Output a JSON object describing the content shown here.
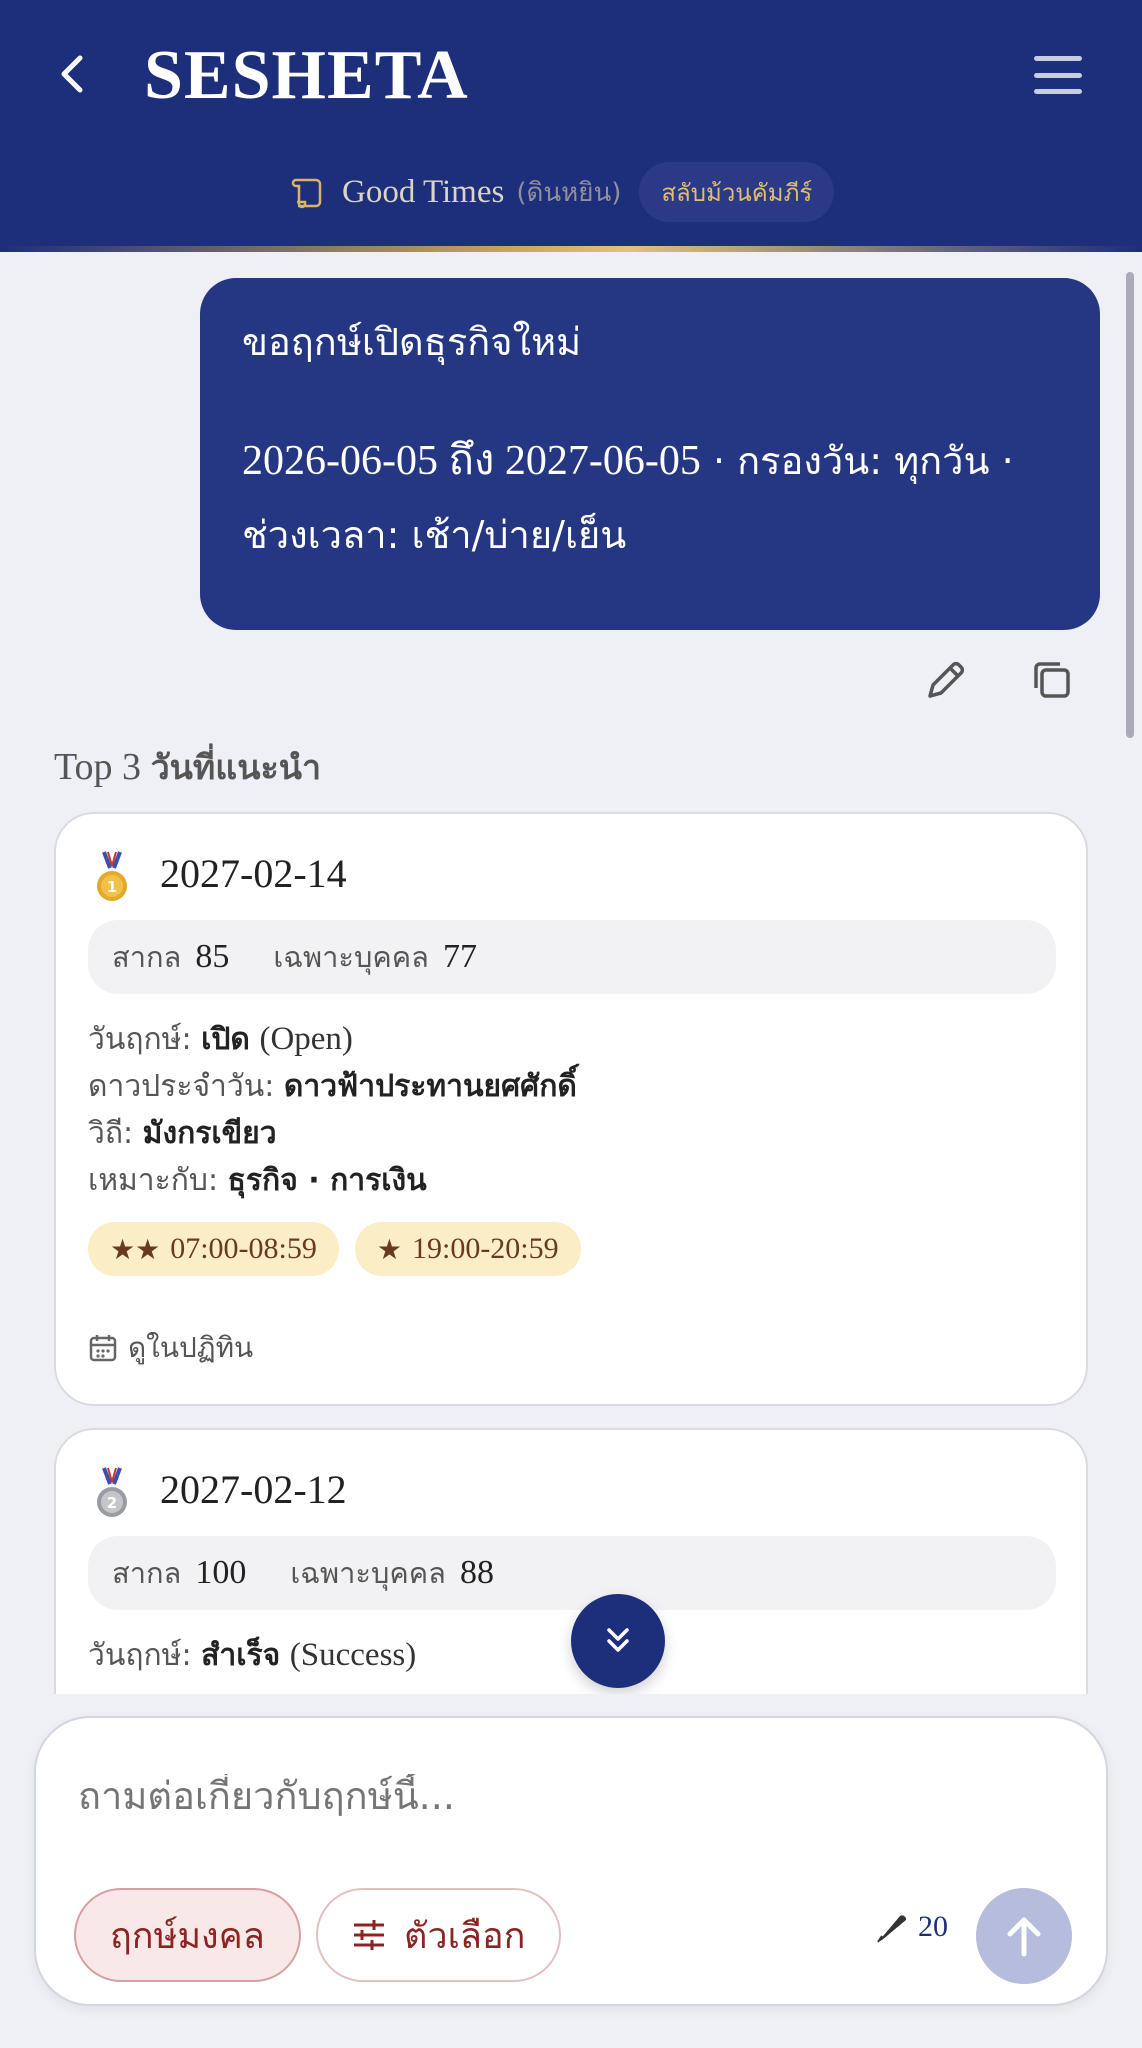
{
  "header": {
    "app_title": "SESHETA",
    "scroll_name": "Good Times",
    "scroll_sub": "(ดินหยิน)",
    "switch_label": "สลับม้วนคัมภีร์",
    "icons": [
      "back-chevron-icon",
      "hamburger-menu-icon",
      "scroll-icon"
    ],
    "accent_color": "#1d2e7a",
    "gold_color": "#e3bd6c"
  },
  "user_message": {
    "line1": "ขอฤกษ์เปิดธุรกิจใหม่",
    "date_range": "2026-06-05 ถึง 2027-06-05",
    "filter_text": " · กรองวัน: ทุกวัน · ช่วงเวลา: เช้า/บ่าย/เย็น",
    "actions": [
      "pencil-icon",
      "copy-icon"
    ]
  },
  "section": {
    "prefix": "Top 3",
    "title": "วันที่แนะนำ"
  },
  "results": [
    {
      "rank_icon": "gold-medal-icon",
      "date": "2027-02-14",
      "score_universal_label": "สากล",
      "score_universal": "85",
      "score_personal_label": "เฉพาะบุคคล",
      "score_personal": "77",
      "day_type_label": "วันฤกษ์:",
      "day_type": "เปิด",
      "day_type_en": "(Open)",
      "star_label": "ดาวประจำวัน:",
      "star": "ดาวฟ้าประทานยศศักดิ์",
      "path_label": "วิถี:",
      "path": "มังกรเขียว",
      "suited_label": "เหมาะกับ:",
      "suited": "ธุรกิจ · การเงิน",
      "slots": [
        {
          "stars": "★★",
          "time": "07:00-08:59"
        },
        {
          "stars": "★",
          "time": "19:00-20:59"
        }
      ],
      "calendar_link": "ดูในปฏิทิน"
    },
    {
      "rank_icon": "silver-medal-icon",
      "date": "2027-02-12",
      "score_universal_label": "สากล",
      "score_universal": "100",
      "score_personal_label": "เฉพาะบุคคล",
      "score_personal": "88",
      "day_type_label": "วันฤกษ์:",
      "day_type": "สำเร็จ",
      "day_type_en": "(Success)"
    }
  ],
  "composer": {
    "placeholder": "ถามต่อเกี่ยวกับฤกษ์นี้...",
    "auspicious_button": "ฤกษ์มงคล",
    "options_button": "ตัวเลือก",
    "credits": "20",
    "icons": [
      "sliders-icon",
      "quill-icon",
      "arrow-up-icon",
      "double-chevron-down-icon"
    ]
  }
}
